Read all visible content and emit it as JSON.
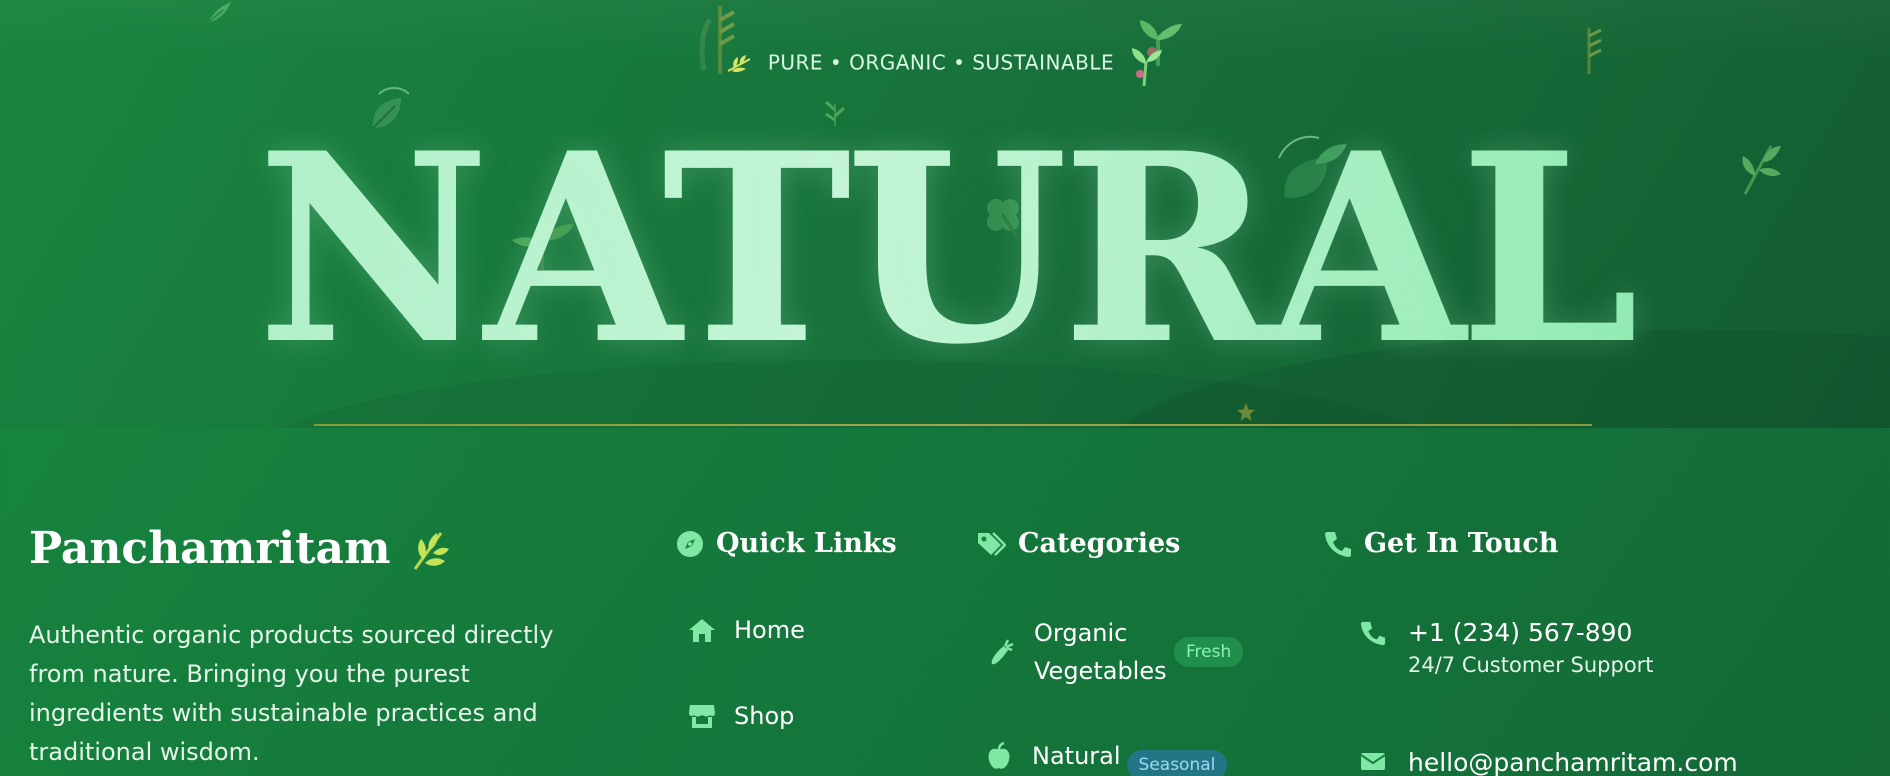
{
  "hero": {
    "tagline": "PURE • ORGANIC • SUSTAINABLE",
    "title": "NATURAL"
  },
  "brand": {
    "name": "Panchamritam",
    "description": "Authentic organic products sourced directly from nature. Bringing you the purest ingredients with sustainable practices and traditional wisdom."
  },
  "quick_links": {
    "heading": "Quick Links",
    "items": [
      {
        "label": "Home",
        "icon": "home-icon"
      },
      {
        "label": "Shop",
        "icon": "store-icon"
      }
    ]
  },
  "categories": {
    "heading": "Categories",
    "items": [
      {
        "label": "Organic Vegetables",
        "badge": "Fresh",
        "icon": "carrot-icon"
      },
      {
        "label": "Natural",
        "badge": "Seasonal",
        "icon": "apple-icon"
      }
    ]
  },
  "contact": {
    "heading": "Get In Touch",
    "items": [
      {
        "value": "+1 (234) 567-890",
        "sub": "24/7 Customer Support",
        "icon": "phone-icon"
      },
      {
        "value": "hello@panchamritam.com",
        "sub": "",
        "icon": "envelope-icon"
      }
    ]
  },
  "colors": {
    "background": "#17803d",
    "accent": "#7ee8a4",
    "title_gradient_start": "#a8efc4",
    "title_gradient_end": "#7fe7a6",
    "rule": "#9aa544"
  }
}
